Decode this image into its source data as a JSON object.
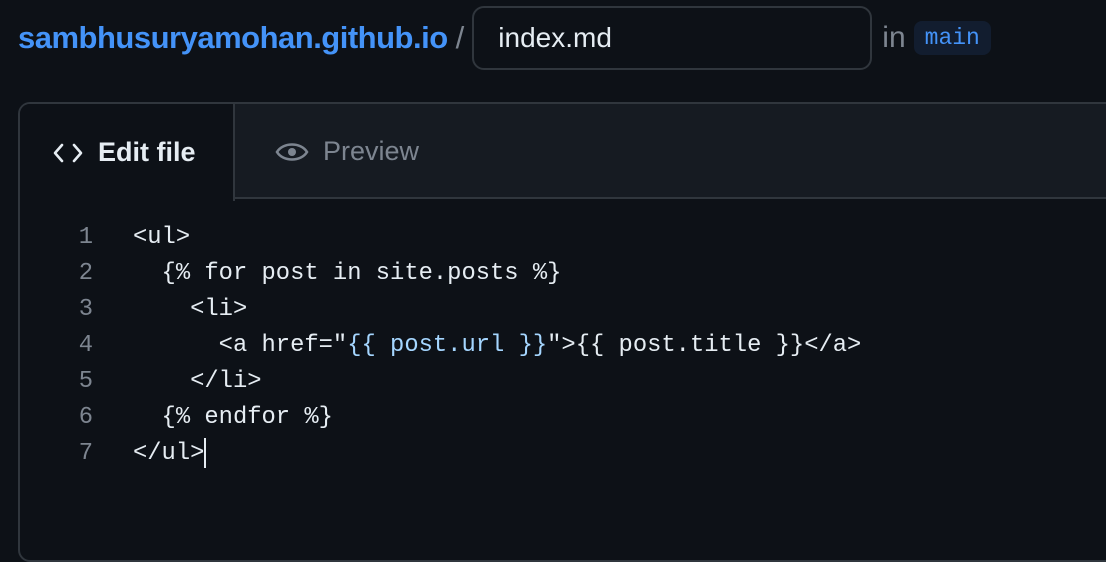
{
  "breadcrumb": {
    "repo": "sambhusuryamohan.github.io",
    "separator": "/",
    "filename": "index.md",
    "in_label": "in",
    "branch": "main"
  },
  "tabs": [
    {
      "label": "Edit file",
      "icon": "code-icon",
      "active": true
    },
    {
      "label": "Preview",
      "icon": "eye-icon",
      "active": false
    }
  ],
  "editor": {
    "lines": [
      {
        "n": "1",
        "text": "<ul>"
      },
      {
        "n": "2",
        "text": "  {% for post in site.posts %}"
      },
      {
        "n": "3",
        "text": "    <li>"
      },
      {
        "n": "4",
        "pre": "      <a href=\"",
        "hl": "{{ post.url }}",
        "post": "\">{{ post.title }}</a>"
      },
      {
        "n": "5",
        "text": "    </li>"
      },
      {
        "n": "6",
        "text": "  {% endfor %}"
      },
      {
        "n": "7",
        "text": "</ul>"
      }
    ]
  },
  "colors": {
    "background": "#0d1117",
    "link": "#4493f8",
    "string": "#a5d6ff"
  }
}
